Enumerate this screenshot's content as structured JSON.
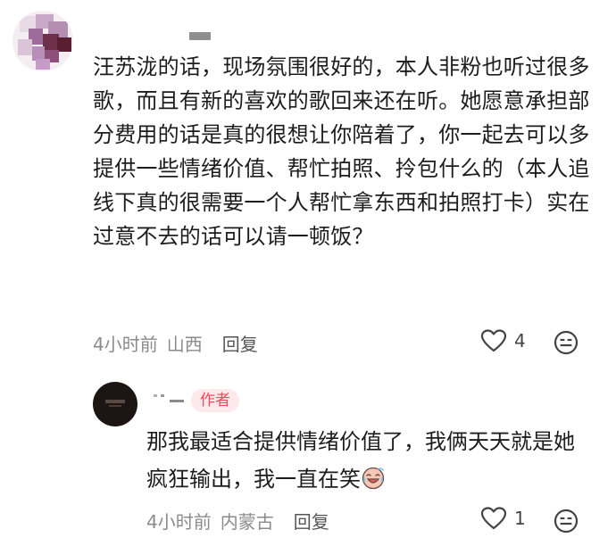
{
  "main_comment": {
    "username": "",
    "text": "汪苏泷的话，现场氛围很好的，本人非粉也听过很多歌，而且有新的喜欢的歌回来还在听。她愿意承担部分费用的话是真的很想让你陪着了，你一起去可以多提供一些情绪价值、帮忙拍照、拎包什么的（本人追线下真的很需要一个人帮忙拿东西和拍照打卡）实在过意不去的话可以请一顿饭？",
    "time": "4小时前",
    "location": "山西",
    "reply_label": "回复",
    "like_count": "4",
    "icons": {
      "like": "heart-outline-icon",
      "reaction": "smiley-face-icon"
    }
  },
  "reply_comment": {
    "username": "",
    "author_badge": "作者",
    "text": "那我最适合提供情绪价值了，我俩天天就是她疯狂输出，我一直在笑",
    "emoji": "laughing-crying-emoji",
    "time": "4小时前",
    "location": "内蒙古",
    "reply_label": "回复",
    "like_count": "1",
    "icons": {
      "like": "heart-outline-icon",
      "reaction": "smiley-face-icon"
    }
  },
  "colors": {
    "badge_text": "#f04a5a",
    "badge_bg": "#fde9ec",
    "meta_text": "#8b8b8b"
  }
}
